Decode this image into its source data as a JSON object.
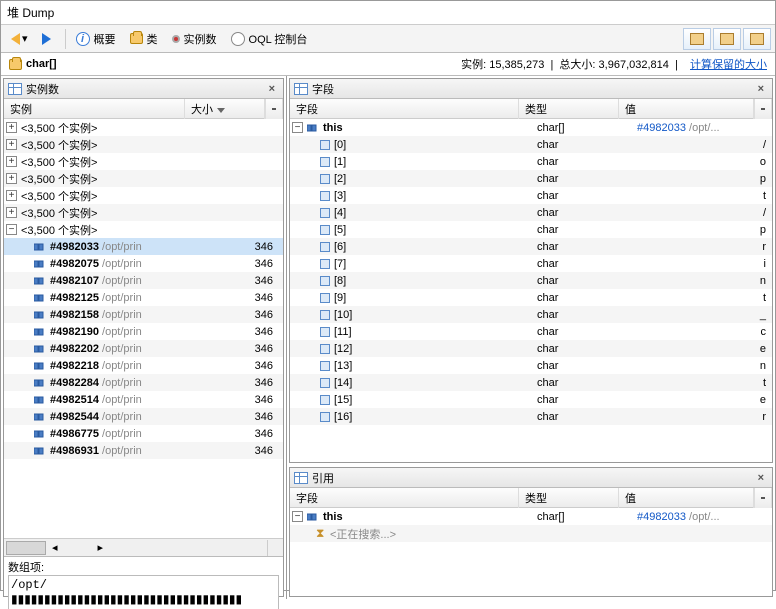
{
  "title": "堆 Dump",
  "toolbar": {
    "overview": "概要",
    "classes": "类",
    "instances": "实例数",
    "oql": "OQL 控制台"
  },
  "path": {
    "type": "char[]"
  },
  "stats": {
    "inst_lbl": "实例:",
    "inst_val": "15,385,273",
    "total_lbl": "总大小:",
    "total_val": "3,967,032,814",
    "link": "计算保留的大小"
  },
  "panels": {
    "instances": "实例数",
    "fields": "字段",
    "refs": "引用"
  },
  "cols": {
    "inst": "实例",
    "size": "大小",
    "field": "字段",
    "type": "类型",
    "value": "值"
  },
  "groups": [
    {
      "txt": "<3,500 个实例>",
      "open": false
    },
    {
      "txt": "<3,500 个实例>",
      "open": false
    },
    {
      "txt": "<3,500 个实例>",
      "open": false
    },
    {
      "txt": "<3,500 个实例>",
      "open": false
    },
    {
      "txt": "<3,500 个实例>",
      "open": false
    },
    {
      "txt": "<3,500 个实例>",
      "open": false
    },
    {
      "txt": "<3,500 个实例>",
      "open": true
    }
  ],
  "inst_rows": [
    {
      "id": "#4982033",
      "path": "/opt/prin",
      "size": "346",
      "sel": true
    },
    {
      "id": "#4982075",
      "path": "/opt/prin",
      "size": "346"
    },
    {
      "id": "#4982107",
      "path": "/opt/prin",
      "size": "346"
    },
    {
      "id": "#4982125",
      "path": "/opt/prin",
      "size": "346"
    },
    {
      "id": "#4982158",
      "path": "/opt/prin",
      "size": "346"
    },
    {
      "id": "#4982190",
      "path": "/opt/prin",
      "size": "346"
    },
    {
      "id": "#4982202",
      "path": "/opt/prin",
      "size": "346"
    },
    {
      "id": "#4982218",
      "path": "/opt/prin",
      "size": "346"
    },
    {
      "id": "#4982284",
      "path": "/opt/prin",
      "size": "346"
    },
    {
      "id": "#4982514",
      "path": "/opt/prin",
      "size": "346"
    },
    {
      "id": "#4982544",
      "path": "/opt/prin",
      "size": "346"
    },
    {
      "id": "#4986775",
      "path": "/opt/prin",
      "size": "346"
    },
    {
      "id": "#4986931",
      "path": "/opt/prin",
      "size": "346"
    }
  ],
  "fields_this": {
    "name": "this",
    "type": "char[]",
    "val_id": "#4982033",
    "val_path": "/opt/..."
  },
  "field_rows": [
    {
      "idx": "[0]",
      "type": "char",
      "val": "/"
    },
    {
      "idx": "[1]",
      "type": "char",
      "val": "o"
    },
    {
      "idx": "[2]",
      "type": "char",
      "val": "p"
    },
    {
      "idx": "[3]",
      "type": "char",
      "val": "t"
    },
    {
      "idx": "[4]",
      "type": "char",
      "val": "/"
    },
    {
      "idx": "[5]",
      "type": "char",
      "val": "p"
    },
    {
      "idx": "[6]",
      "type": "char",
      "val": "r"
    },
    {
      "idx": "[7]",
      "type": "char",
      "val": "i"
    },
    {
      "idx": "[8]",
      "type": "char",
      "val": "n"
    },
    {
      "idx": "[9]",
      "type": "char",
      "val": "t"
    },
    {
      "idx": "[10]",
      "type": "char",
      "val": "_"
    },
    {
      "idx": "[11]",
      "type": "char",
      "val": "c"
    },
    {
      "idx": "[12]",
      "type": "char",
      "val": "e"
    },
    {
      "idx": "[13]",
      "type": "char",
      "val": "n"
    },
    {
      "idx": "[14]",
      "type": "char",
      "val": "t"
    },
    {
      "idx": "[15]",
      "type": "char",
      "val": "e"
    },
    {
      "idx": "[16]",
      "type": "char",
      "val": "r"
    }
  ],
  "refs_this": {
    "name": "this",
    "type": "char[]",
    "val_id": "#4982033",
    "val_path": "/opt/..."
  },
  "refs_loading": "<正在搜索...>",
  "arr_label": "数组项:",
  "arr_value": "/opt/▮▮▮▮▮▮▮▮▮▮▮▮▮▮▮▮▮▮▮▮▮▮▮▮▮▮▮▮▮▮▮▮▮▮▮"
}
